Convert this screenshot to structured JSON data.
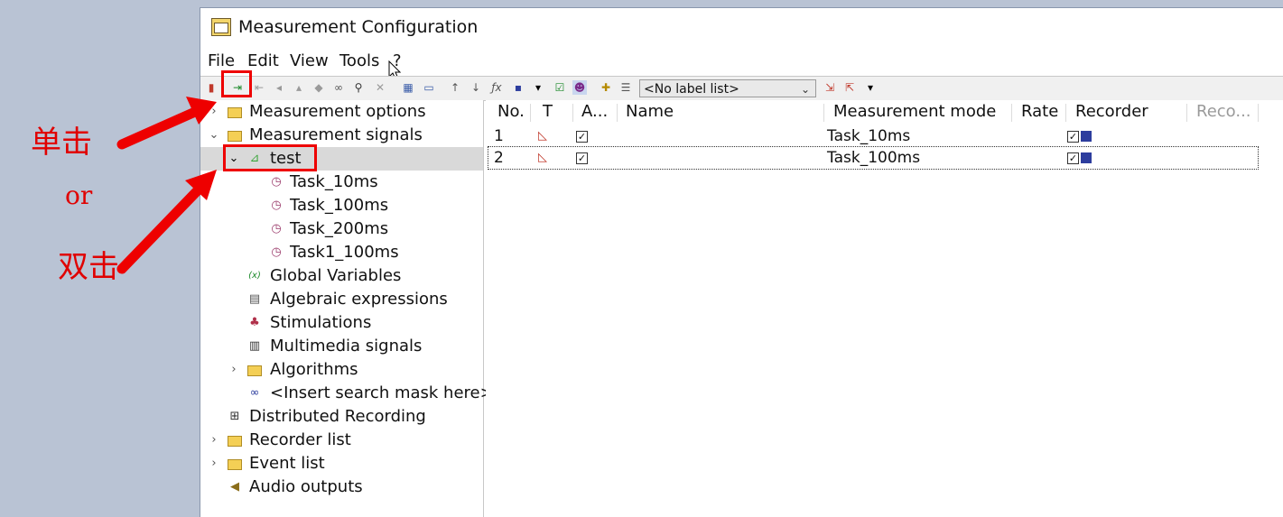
{
  "window": {
    "title": "Measurement Configuration"
  },
  "menu": [
    "File",
    "Edit",
    "View",
    "Tools",
    "?"
  ],
  "toolbar": {
    "label_select": "<No label list>"
  },
  "tree": {
    "measurement_options": "Measurement options",
    "measurement_signals": "Measurement signals",
    "test": "test",
    "task_10ms": "Task_10ms",
    "task_100ms": "Task_100ms",
    "task_200ms": "Task_200ms",
    "task1_100ms": "Task1_100ms",
    "global_variables": "Global Variables",
    "algebraic_expressions": "Algebraic expressions",
    "stimulations": "Stimulations",
    "multimedia_signals": "Multimedia signals",
    "algorithms": "Algorithms",
    "search_mask": "<Insert search mask here>",
    "distributed_recording": "Distributed Recording",
    "recorder_list": "Recorder list",
    "event_list": "Event list",
    "audio_outputs": "Audio outputs"
  },
  "grid": {
    "columns": [
      "No.",
      "T",
      "A...",
      "Name",
      "Measurement mode",
      "Rate",
      "Recorder",
      "Reco..."
    ],
    "rows": [
      {
        "no": "1",
        "mode": "Task_10ms"
      },
      {
        "no": "2",
        "mode": "Task_100ms"
      }
    ]
  },
  "annotations": {
    "single_click": "单击",
    "or": "or",
    "double_click": "双击"
  },
  "colors": {
    "annotation_red": "#ee0000",
    "background": "#b9c3d4"
  }
}
